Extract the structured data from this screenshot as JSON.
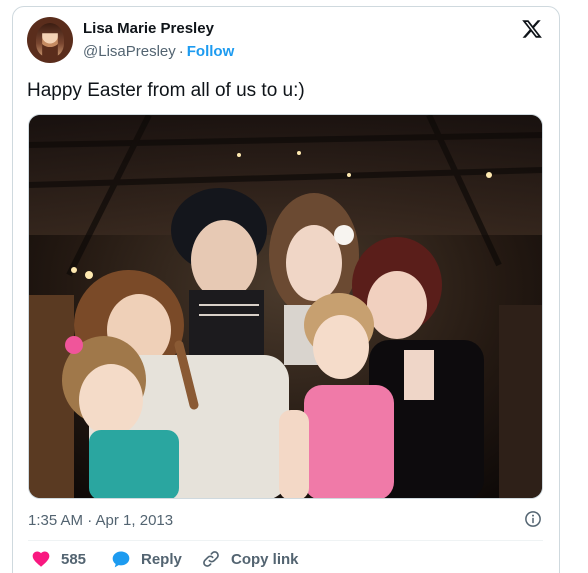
{
  "author": {
    "name": "Lisa Marie Presley",
    "handle": "@LisaPresley",
    "separator": "·",
    "follow_label": "Follow"
  },
  "tweet": {
    "text": "Happy Easter from all of us to u:)",
    "timestamp": "1:35 AM · Apr 1, 2013"
  },
  "actions": {
    "likes_count": "585",
    "reply_label": "Reply",
    "copy_link_label": "Copy link"
  },
  "icons": {
    "brand": "x-logo-icon",
    "info": "info-icon",
    "like": "heart-icon",
    "reply": "speech-bubble-icon",
    "copy": "link-icon"
  },
  "colors": {
    "accent": "#1d9bf0",
    "like": "#f91880",
    "secondary_text": "#536471"
  }
}
